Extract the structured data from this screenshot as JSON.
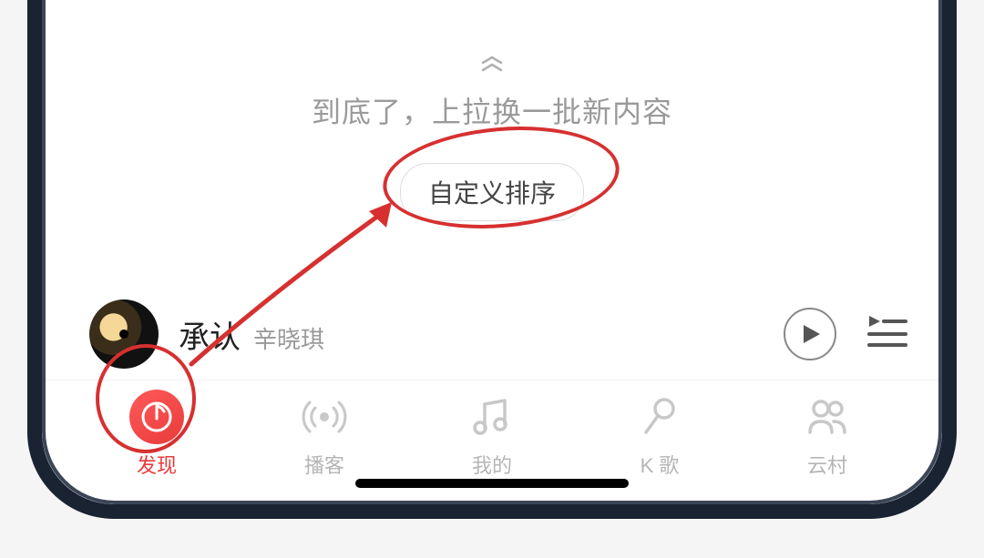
{
  "scrollEnd": {
    "message": "到底了，上拉换一批新内容",
    "sortBtn": "自定义排序"
  },
  "nowPlaying": {
    "title": "承认",
    "artist": "辛晓琪"
  },
  "nav": {
    "items": [
      {
        "label": "发现",
        "active": true
      },
      {
        "label": "播客",
        "active": false
      },
      {
        "label": "我的",
        "active": false
      },
      {
        "label": "K 歌",
        "active": false
      },
      {
        "label": "云村",
        "active": false
      }
    ]
  },
  "colors": {
    "accent": "#e83b3b",
    "annotation": "#d73030"
  }
}
